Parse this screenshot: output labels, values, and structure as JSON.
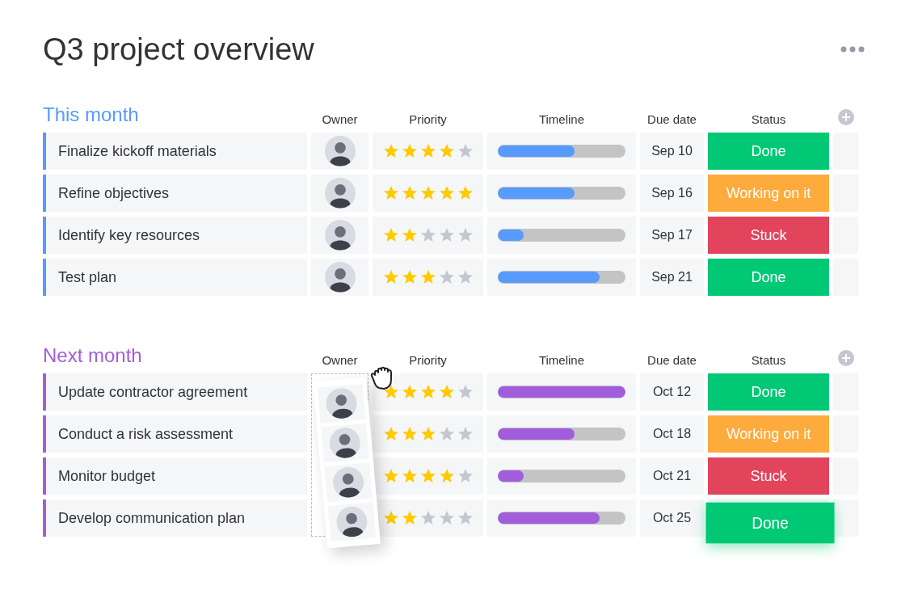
{
  "title": "Q3 project overview",
  "groups": [
    {
      "name": "This month",
      "color": "#579bfc",
      "owner_dragged": false,
      "columns": [
        "Owner",
        "Priority",
        "Timeline",
        "Due date",
        "Status"
      ],
      "rows": [
        {
          "task": "Finalize kickoff materials",
          "stars": 4,
          "level": 0.6,
          "due": "Sep 10",
          "status": "Done",
          "color": "#00c875",
          "lifted": false
        },
        {
          "task": "Refine objectives",
          "stars": 5,
          "level": 0.6,
          "due": "Sep 16",
          "status": "Working on it",
          "color": "#fdab3d",
          "lifted": false
        },
        {
          "task": "Identify key resources",
          "stars": 2,
          "level": 0.2,
          "due": "Sep 17",
          "status": "Stuck",
          "color": "#e2445c",
          "lifted": false
        },
        {
          "task": "Test plan",
          "stars": 3,
          "level": 0.8,
          "due": "Sep 21",
          "status": "Done",
          "color": "#00c875",
          "lifted": false
        }
      ]
    },
    {
      "name": "Next month",
      "color": "#a25ddc",
      "owner_dragged": true,
      "columns": [
        "Owner",
        "Priority",
        "Timeline",
        "Due date",
        "Status"
      ],
      "rows": [
        {
          "task": "Update contractor agreement",
          "stars": 4,
          "level": 1.0,
          "due": "Oct 12",
          "status": "Done",
          "color": "#00c875",
          "lifted": false
        },
        {
          "task": "Conduct a risk assessment",
          "stars": 3,
          "level": 0.6,
          "due": "Oct 18",
          "status": "Working on it",
          "color": "#fdab3d",
          "lifted": false
        },
        {
          "task": "Monitor budget",
          "stars": 4,
          "level": 0.2,
          "due": "Oct 21",
          "status": "Stuck",
          "color": "#e2445c",
          "lifted": false
        },
        {
          "task": "Develop communication plan",
          "stars": 2,
          "level": 0.8,
          "due": "Oct 25",
          "status": "Done",
          "color": "#00c875",
          "lifted": true
        }
      ]
    }
  ]
}
